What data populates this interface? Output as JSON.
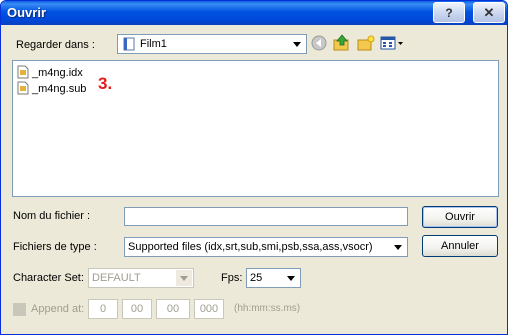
{
  "window": {
    "title": "Ouvrir"
  },
  "titlebar_buttons": {
    "help": "?",
    "close": "✕"
  },
  "look_in": {
    "label": "Regarder dans :",
    "value": "Film1"
  },
  "files": [
    {
      "name": "_m4ng.idx"
    },
    {
      "name": "_m4ng.sub"
    }
  ],
  "annotation": "3.",
  "filename": {
    "label": "Nom du fichier :",
    "value": ""
  },
  "filetype": {
    "label": "Fichiers de type :",
    "value": "Supported files (idx,srt,sub,smi,psb,ssa,ass,vsocr)"
  },
  "buttons": {
    "open": "Ouvrir",
    "cancel": "Annuler"
  },
  "charset": {
    "label": "Character Set:",
    "value": "DEFAULT"
  },
  "fps": {
    "label": "Fps:",
    "value": "25"
  },
  "append": {
    "label": "Append at:",
    "fields": [
      "0",
      "00",
      "00",
      "000"
    ],
    "hint": "(hh:mm:ss.ms)"
  },
  "colors": {
    "accent": "#0053e1",
    "annotation": "#e41b1b",
    "dialog_bg": "#ece9d8"
  }
}
